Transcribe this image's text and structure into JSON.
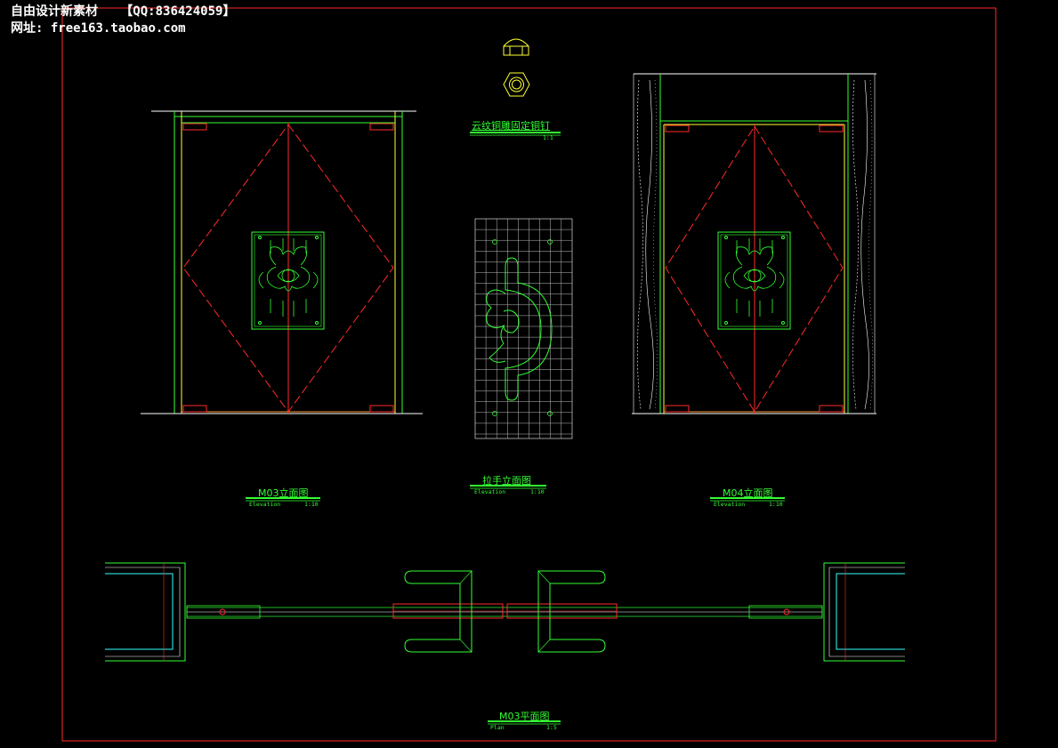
{
  "watermark": {
    "line1_name": "自由设计新素材",
    "line1_qq": "【QQ:836424059】",
    "line2_label": "网址:",
    "line2_url": "free163.taobao.com"
  },
  "colors": {
    "background": "#000000",
    "frame": "#ff2a2a",
    "green": "#33ff33",
    "yellow": "#ffff33",
    "red": "#ff2a2a",
    "cyan": "#33ffff",
    "white": "#ffffff"
  },
  "labels": {
    "nail_detail": {
      "title": "云纹铜雕固定铜钉",
      "scale": "1:1"
    },
    "handle_elev": {
      "title": "拉手立面图",
      "sub": "Elevation",
      "scale": "1:10"
    },
    "m03_elev": {
      "title": "M03立面图",
      "sub": "Elevation",
      "scale": "1:10"
    },
    "m04_elev": {
      "title": "M04立面图",
      "sub": "Elevation",
      "scale": "1:10"
    },
    "m03_plan": {
      "title": "M03平面图",
      "sub": "Plan",
      "scale": "1:5"
    }
  },
  "icons": {
    "nail_top": "dome-nail-side-icon",
    "nail_front": "hexagon-nail-top-icon",
    "cloud_motif": "cloud-pattern-ornament"
  }
}
